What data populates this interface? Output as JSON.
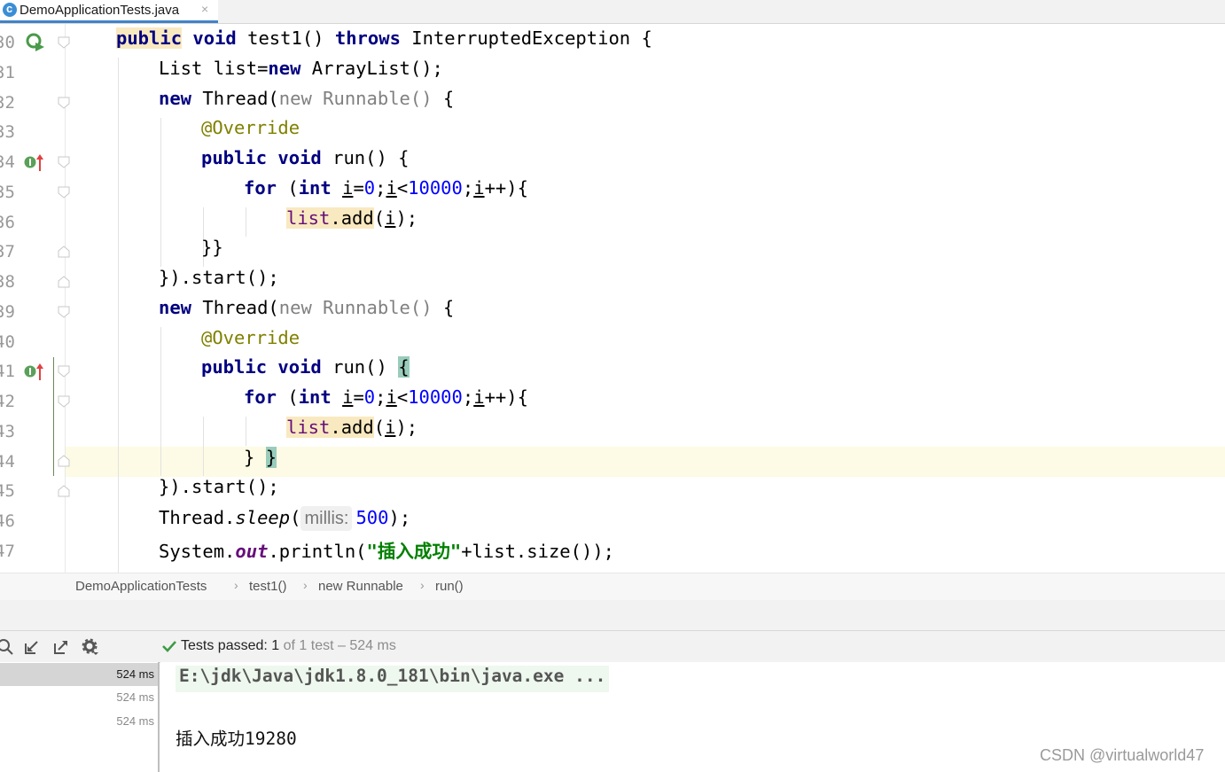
{
  "tab": {
    "filename": "DemoApplicationTests.java",
    "close": "×"
  },
  "gutter": {
    "line_numbers": [
      "30",
      "31",
      "32",
      "33",
      "34",
      "35",
      "36",
      "37",
      "38",
      "39",
      "40",
      "41",
      "42",
      "43",
      "44",
      "45",
      "46",
      "47"
    ]
  },
  "code": {
    "l30": {
      "kw1": "public",
      "kw2": "void",
      "name": "test1()",
      "kw3": "throws",
      "rest": "InterruptedException {"
    },
    "l31": {
      "a": "List list=",
      "kw": "new",
      "b": "ArrayList();"
    },
    "l32": {
      "kw": "new",
      "a": "Thread(",
      "grey": "new Runnable()",
      "b": "{"
    },
    "l33": {
      "ann": "@Override"
    },
    "l34": {
      "kw1": "public",
      "kw2": "void",
      "rest": "run() {"
    },
    "l35": {
      "kw1": "for",
      "a": "(",
      "kw2": "int",
      "i1": "i",
      "eq": "=",
      "zero": "0",
      "semi1": ";",
      "i2": "i",
      "lt": "<",
      "limit": "10000",
      "semi2": ";",
      "i3": "i",
      "rest": "++){"
    },
    "l36": {
      "list": "list",
      "add": ".add",
      "a": "(",
      "i": "i",
      "b": ");"
    },
    "l37": {
      "text": "}}"
    },
    "l38": {
      "text": "}).start();"
    },
    "l39": {
      "kw": "new",
      "a": "Thread(",
      "grey": "new Runnable()",
      "b": "{"
    },
    "l40": {
      "ann": "@Override"
    },
    "l41": {
      "kw1": "public",
      "kw2": "void",
      "rest": "run()",
      "brace": "{"
    },
    "l42": {
      "kw1": "for",
      "a": "(",
      "kw2": "int",
      "i1": "i",
      "eq": "=",
      "zero": "0",
      "semi1": ";",
      "i2": "i",
      "lt": "<",
      "limit": "10000",
      "semi2": ";",
      "i3": "i",
      "rest": "++){"
    },
    "l43": {
      "list": "list",
      "add": ".add",
      "a": "(",
      "i": "i",
      "b": ");"
    },
    "l44": {
      "a": "}",
      "brace": "}"
    },
    "l45": {
      "text": "}).start();"
    },
    "l46": {
      "a": "Thread.",
      "sleep": "sleep",
      "b": "(",
      "hint": "millis:",
      "num": "500",
      "c": ");"
    },
    "l47": {
      "a": "System.",
      "out": "out",
      "b": ".println(",
      "str": "\"插入成功\"",
      "c": "+list.size());"
    }
  },
  "breadcrumb": [
    "DemoApplicationTests",
    "test1()",
    "new Runnable",
    "run()"
  ],
  "breadcrumb_sep": "›",
  "run": {
    "status_prefix": "Tests passed:",
    "status_count": "1",
    "status_rest": "of 1 test – 524 ms",
    "tree": [
      "524 ms",
      "524 ms",
      "524 ms"
    ],
    "command": "E:\\jdk\\Java\\jdk1.8.0_181\\bin\\java.exe ...",
    "output": "插入成功19280"
  },
  "watermark": "CSDN @virtualworld47"
}
